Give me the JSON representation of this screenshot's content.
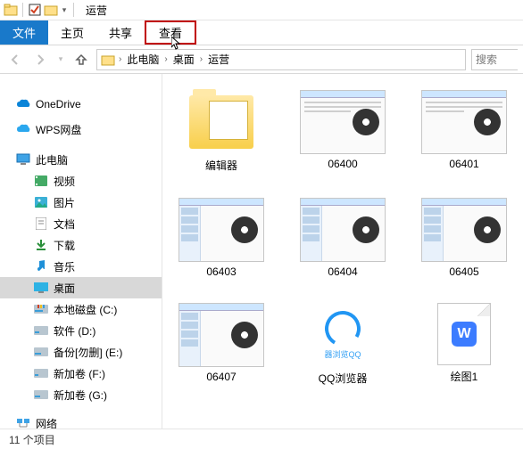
{
  "window": {
    "title": "运营"
  },
  "ribbon": {
    "file": "文件",
    "home": "主页",
    "share": "共享",
    "view": "查看"
  },
  "nav": {
    "breadcrumb": {
      "root": "此电脑",
      "seg1": "桌面",
      "seg2": "运营"
    },
    "search_placeholder": "搜索"
  },
  "sidebar": {
    "onedrive": "OneDrive",
    "wps": "WPS网盘",
    "thispc": "此电脑",
    "videos": "视频",
    "pictures": "图片",
    "documents": "文档",
    "downloads": "下载",
    "music": "音乐",
    "desktop": "桌面",
    "disk_c": "本地磁盘 (C:)",
    "disk_d": "软件 (D:)",
    "disk_e": "备份[勿删] (E:)",
    "disk_f": "新加卷 (F:)",
    "disk_g": "新加卷 (G:)",
    "network": "网络"
  },
  "items": [
    {
      "label": "编辑器",
      "type": "folder"
    },
    {
      "label": "06400",
      "type": "video"
    },
    {
      "label": "06401",
      "type": "video"
    },
    {
      "label": "06403",
      "type": "video-list"
    },
    {
      "label": "06404",
      "type": "video-list"
    },
    {
      "label": "06405",
      "type": "video-list"
    },
    {
      "label": "06407",
      "type": "video-list"
    },
    {
      "label": "QQ浏览器",
      "type": "qq",
      "sublabel": "器浏览QQ"
    },
    {
      "label": "绘图1",
      "type": "wps"
    }
  ],
  "status": {
    "count_label": "11 个项目"
  }
}
